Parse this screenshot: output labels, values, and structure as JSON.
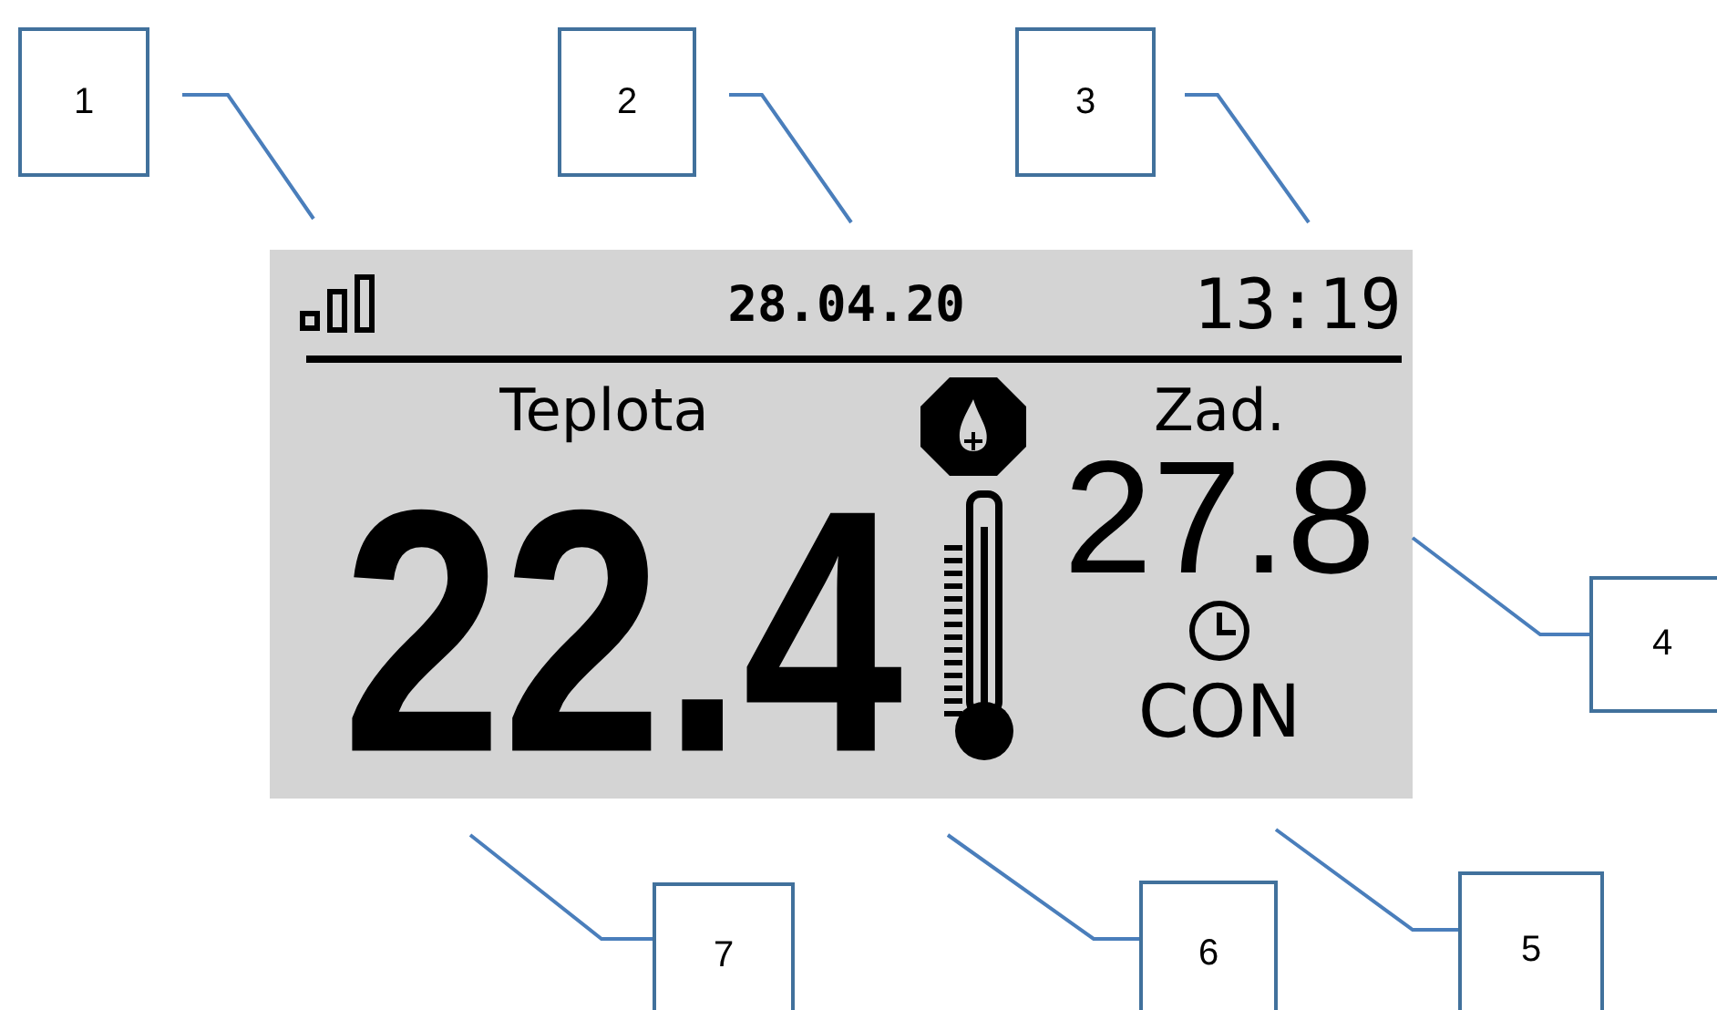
{
  "display": {
    "date": "28.04.20",
    "time": "13:19",
    "temperature_label": "Teplota",
    "temperature": "22.4",
    "setpoint_label": "Zad.",
    "setpoint": "27.8",
    "mode": "CON"
  },
  "callouts": [
    "1",
    "2",
    "3",
    "4",
    "7",
    "6",
    "5"
  ]
}
